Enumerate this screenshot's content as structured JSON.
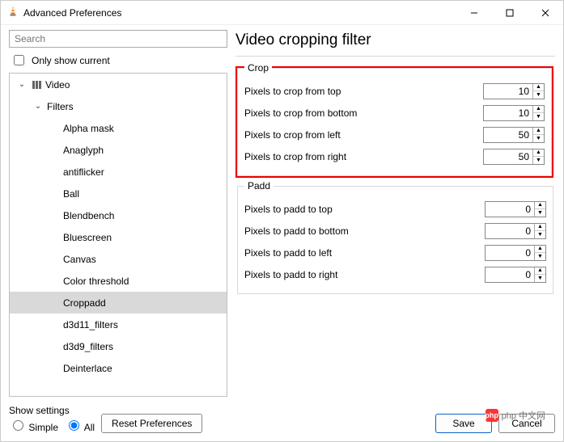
{
  "window": {
    "title": "Advanced Preferences"
  },
  "search": {
    "placeholder": "Search"
  },
  "only_current": "Only show current",
  "tree": {
    "root": "Video",
    "filters": "Filters",
    "items": [
      "Alpha mask",
      "Anaglyph",
      "antiflicker",
      "Ball",
      "Blendbench",
      "Bluescreen",
      "Canvas",
      "Color threshold",
      "Croppadd",
      "d3d11_filters",
      "d3d9_filters",
      "Deinterlace"
    ],
    "selected": "Croppadd"
  },
  "page": {
    "title": "Video cropping filter",
    "crop": {
      "legend": "Crop",
      "fields": [
        {
          "label": "Pixels to crop from top",
          "value": "10"
        },
        {
          "label": "Pixels to crop from bottom",
          "value": "10"
        },
        {
          "label": "Pixels to crop from left",
          "value": "50"
        },
        {
          "label": "Pixels to crop from right",
          "value": "50"
        }
      ]
    },
    "padd": {
      "legend": "Padd",
      "fields": [
        {
          "label": "Pixels to padd to top",
          "value": "0"
        },
        {
          "label": "Pixels to padd to bottom",
          "value": "0"
        },
        {
          "label": "Pixels to padd to left",
          "value": "0"
        },
        {
          "label": "Pixels to padd to right",
          "value": "0"
        }
      ]
    }
  },
  "footer": {
    "show_settings": "Show settings",
    "simple": "Simple",
    "all": "All",
    "reset": "Reset Preferences",
    "save": "Save",
    "cancel": "Cancel"
  },
  "watermark": "php 中文网"
}
